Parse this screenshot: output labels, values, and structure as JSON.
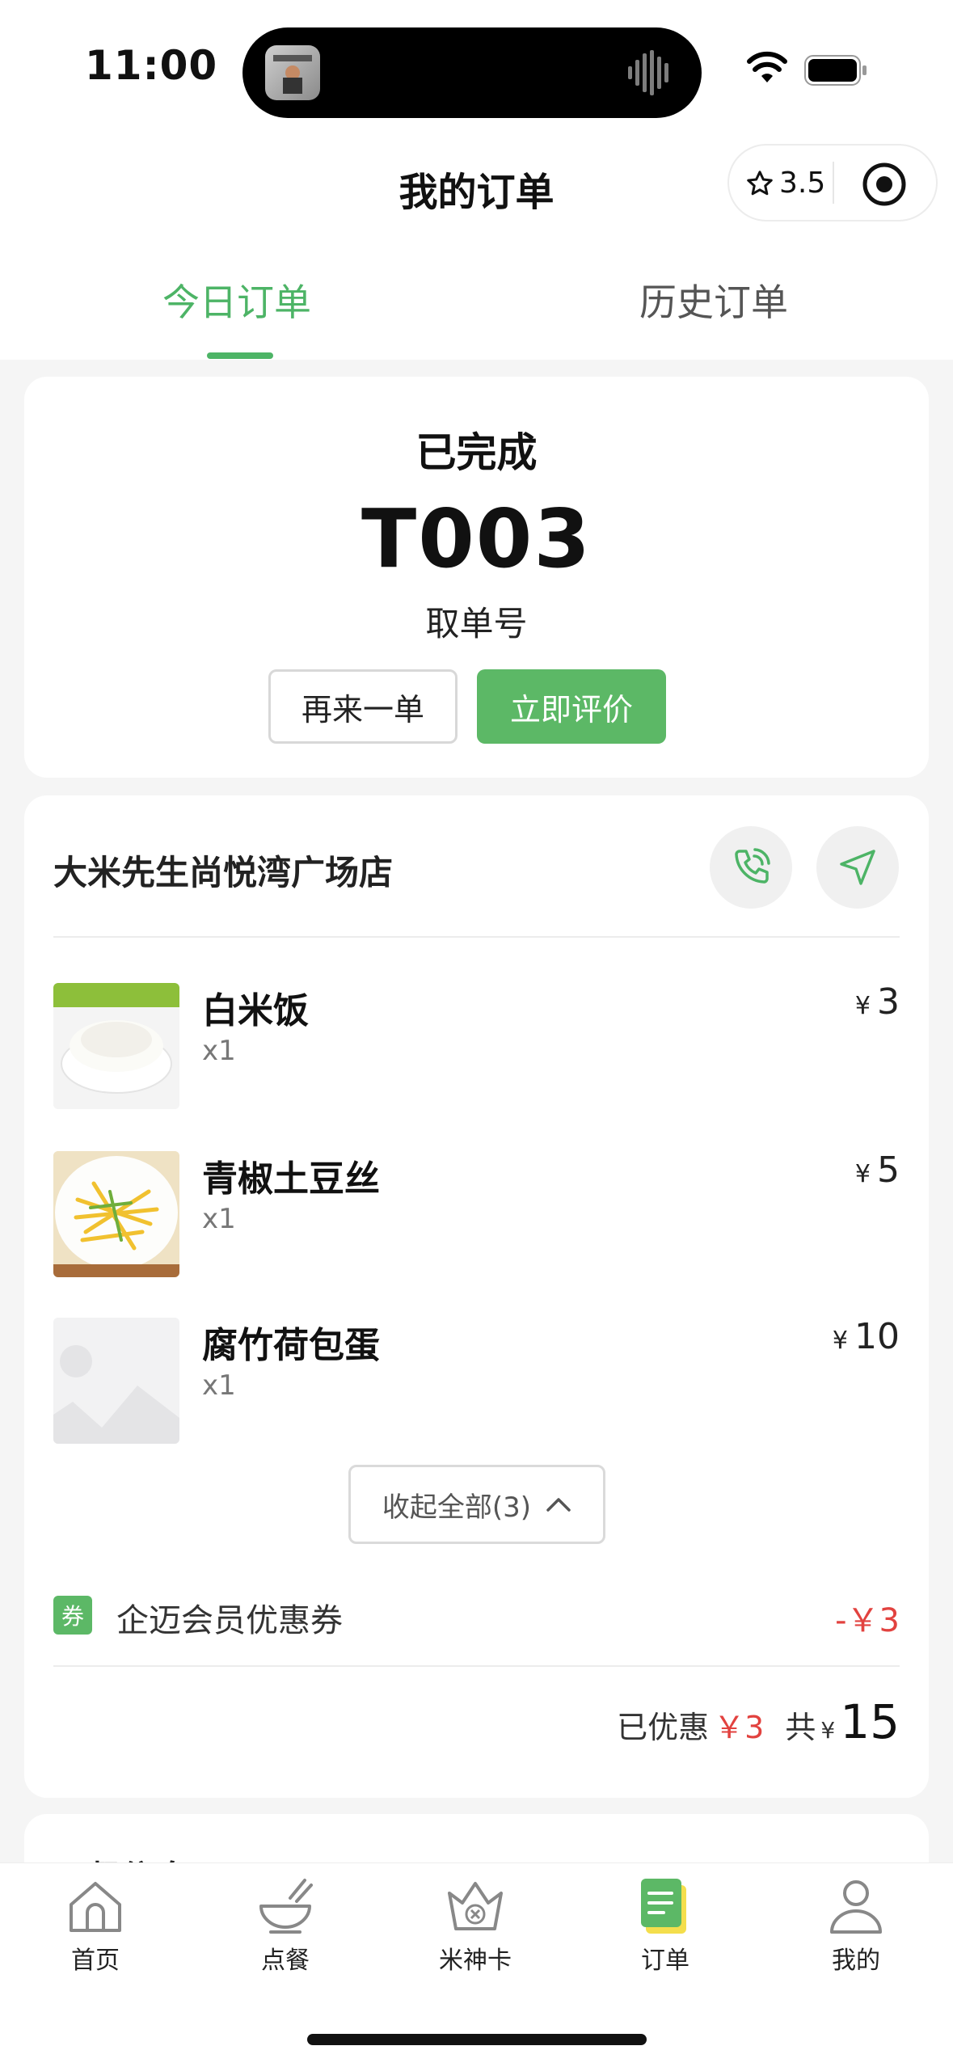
{
  "status_bar": {
    "time": "11:00"
  },
  "header": {
    "title": "我的订单",
    "rating": "3.5"
  },
  "tabs": [
    {
      "label": "今日订单",
      "active": true
    },
    {
      "label": "历史订单",
      "active": false
    }
  ],
  "order_status": {
    "status": "已完成",
    "pickup_code": "T003",
    "pickup_label": "取单号",
    "reorder_label": "再来一单",
    "review_label": "立即评价"
  },
  "store": {
    "name": "大米先生尚悦湾广场店"
  },
  "items": [
    {
      "name": "白米饭",
      "qty": "x1",
      "currency": "¥",
      "price": "3",
      "image": "rice-image"
    },
    {
      "name": "青椒土豆丝",
      "qty": "x1",
      "currency": "¥",
      "price": "5",
      "image": "potato-image"
    },
    {
      "name": "腐竹荷包蛋",
      "qty": "x1",
      "currency": "¥",
      "price": "10",
      "image": "placeholder-image"
    }
  ],
  "collapse_label": "收起全部(3)",
  "coupon": {
    "badge": "券",
    "label": "企迈会员优惠券",
    "amount": "-￥3"
  },
  "totals": {
    "discount_label": "已优惠",
    "discount_value": "￥3",
    "total_label": "共",
    "currency": "¥",
    "total_value": "15"
  },
  "dining_info": {
    "title": "用餐信息"
  },
  "tabbar": [
    {
      "label": "首页",
      "icon": "home-icon"
    },
    {
      "label": "点餐",
      "icon": "bowl-icon"
    },
    {
      "label": "米神卡",
      "icon": "crown-icon"
    },
    {
      "label": "订单",
      "icon": "order-icon",
      "active": true
    },
    {
      "label": "我的",
      "icon": "user-icon"
    }
  ],
  "colors": {
    "accent": "#4db466",
    "button_green": "#5cb866",
    "discount_red": "#e2423f"
  }
}
